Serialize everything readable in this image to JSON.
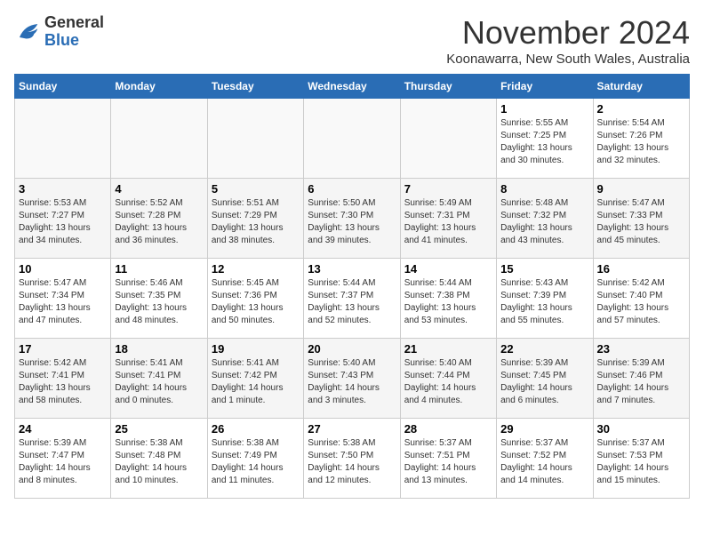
{
  "logo": {
    "text_general": "General",
    "text_blue": "Blue"
  },
  "header": {
    "month_title": "November 2024",
    "location": "Koonawarra, New South Wales, Australia"
  },
  "weekdays": [
    "Sunday",
    "Monday",
    "Tuesday",
    "Wednesday",
    "Thursday",
    "Friday",
    "Saturday"
  ],
  "weeks": [
    [
      {
        "day": "",
        "info": ""
      },
      {
        "day": "",
        "info": ""
      },
      {
        "day": "",
        "info": ""
      },
      {
        "day": "",
        "info": ""
      },
      {
        "day": "",
        "info": ""
      },
      {
        "day": "1",
        "info": "Sunrise: 5:55 AM\nSunset: 7:25 PM\nDaylight: 13 hours\nand 30 minutes."
      },
      {
        "day": "2",
        "info": "Sunrise: 5:54 AM\nSunset: 7:26 PM\nDaylight: 13 hours\nand 32 minutes."
      }
    ],
    [
      {
        "day": "3",
        "info": "Sunrise: 5:53 AM\nSunset: 7:27 PM\nDaylight: 13 hours\nand 34 minutes."
      },
      {
        "day": "4",
        "info": "Sunrise: 5:52 AM\nSunset: 7:28 PM\nDaylight: 13 hours\nand 36 minutes."
      },
      {
        "day": "5",
        "info": "Sunrise: 5:51 AM\nSunset: 7:29 PM\nDaylight: 13 hours\nand 38 minutes."
      },
      {
        "day": "6",
        "info": "Sunrise: 5:50 AM\nSunset: 7:30 PM\nDaylight: 13 hours\nand 39 minutes."
      },
      {
        "day": "7",
        "info": "Sunrise: 5:49 AM\nSunset: 7:31 PM\nDaylight: 13 hours\nand 41 minutes."
      },
      {
        "day": "8",
        "info": "Sunrise: 5:48 AM\nSunset: 7:32 PM\nDaylight: 13 hours\nand 43 minutes."
      },
      {
        "day": "9",
        "info": "Sunrise: 5:47 AM\nSunset: 7:33 PM\nDaylight: 13 hours\nand 45 minutes."
      }
    ],
    [
      {
        "day": "10",
        "info": "Sunrise: 5:47 AM\nSunset: 7:34 PM\nDaylight: 13 hours\nand 47 minutes."
      },
      {
        "day": "11",
        "info": "Sunrise: 5:46 AM\nSunset: 7:35 PM\nDaylight: 13 hours\nand 48 minutes."
      },
      {
        "day": "12",
        "info": "Sunrise: 5:45 AM\nSunset: 7:36 PM\nDaylight: 13 hours\nand 50 minutes."
      },
      {
        "day": "13",
        "info": "Sunrise: 5:44 AM\nSunset: 7:37 PM\nDaylight: 13 hours\nand 52 minutes."
      },
      {
        "day": "14",
        "info": "Sunrise: 5:44 AM\nSunset: 7:38 PM\nDaylight: 13 hours\nand 53 minutes."
      },
      {
        "day": "15",
        "info": "Sunrise: 5:43 AM\nSunset: 7:39 PM\nDaylight: 13 hours\nand 55 minutes."
      },
      {
        "day": "16",
        "info": "Sunrise: 5:42 AM\nSunset: 7:40 PM\nDaylight: 13 hours\nand 57 minutes."
      }
    ],
    [
      {
        "day": "17",
        "info": "Sunrise: 5:42 AM\nSunset: 7:41 PM\nDaylight: 13 hours\nand 58 minutes."
      },
      {
        "day": "18",
        "info": "Sunrise: 5:41 AM\nSunset: 7:41 PM\nDaylight: 14 hours\nand 0 minutes."
      },
      {
        "day": "19",
        "info": "Sunrise: 5:41 AM\nSunset: 7:42 PM\nDaylight: 14 hours\nand 1 minute."
      },
      {
        "day": "20",
        "info": "Sunrise: 5:40 AM\nSunset: 7:43 PM\nDaylight: 14 hours\nand 3 minutes."
      },
      {
        "day": "21",
        "info": "Sunrise: 5:40 AM\nSunset: 7:44 PM\nDaylight: 14 hours\nand 4 minutes."
      },
      {
        "day": "22",
        "info": "Sunrise: 5:39 AM\nSunset: 7:45 PM\nDaylight: 14 hours\nand 6 minutes."
      },
      {
        "day": "23",
        "info": "Sunrise: 5:39 AM\nSunset: 7:46 PM\nDaylight: 14 hours\nand 7 minutes."
      }
    ],
    [
      {
        "day": "24",
        "info": "Sunrise: 5:39 AM\nSunset: 7:47 PM\nDaylight: 14 hours\nand 8 minutes."
      },
      {
        "day": "25",
        "info": "Sunrise: 5:38 AM\nSunset: 7:48 PM\nDaylight: 14 hours\nand 10 minutes."
      },
      {
        "day": "26",
        "info": "Sunrise: 5:38 AM\nSunset: 7:49 PM\nDaylight: 14 hours\nand 11 minutes."
      },
      {
        "day": "27",
        "info": "Sunrise: 5:38 AM\nSunset: 7:50 PM\nDaylight: 14 hours\nand 12 minutes."
      },
      {
        "day": "28",
        "info": "Sunrise: 5:37 AM\nSunset: 7:51 PM\nDaylight: 14 hours\nand 13 minutes."
      },
      {
        "day": "29",
        "info": "Sunrise: 5:37 AM\nSunset: 7:52 PM\nDaylight: 14 hours\nand 14 minutes."
      },
      {
        "day": "30",
        "info": "Sunrise: 5:37 AM\nSunset: 7:53 PM\nDaylight: 14 hours\nand 15 minutes."
      }
    ]
  ]
}
